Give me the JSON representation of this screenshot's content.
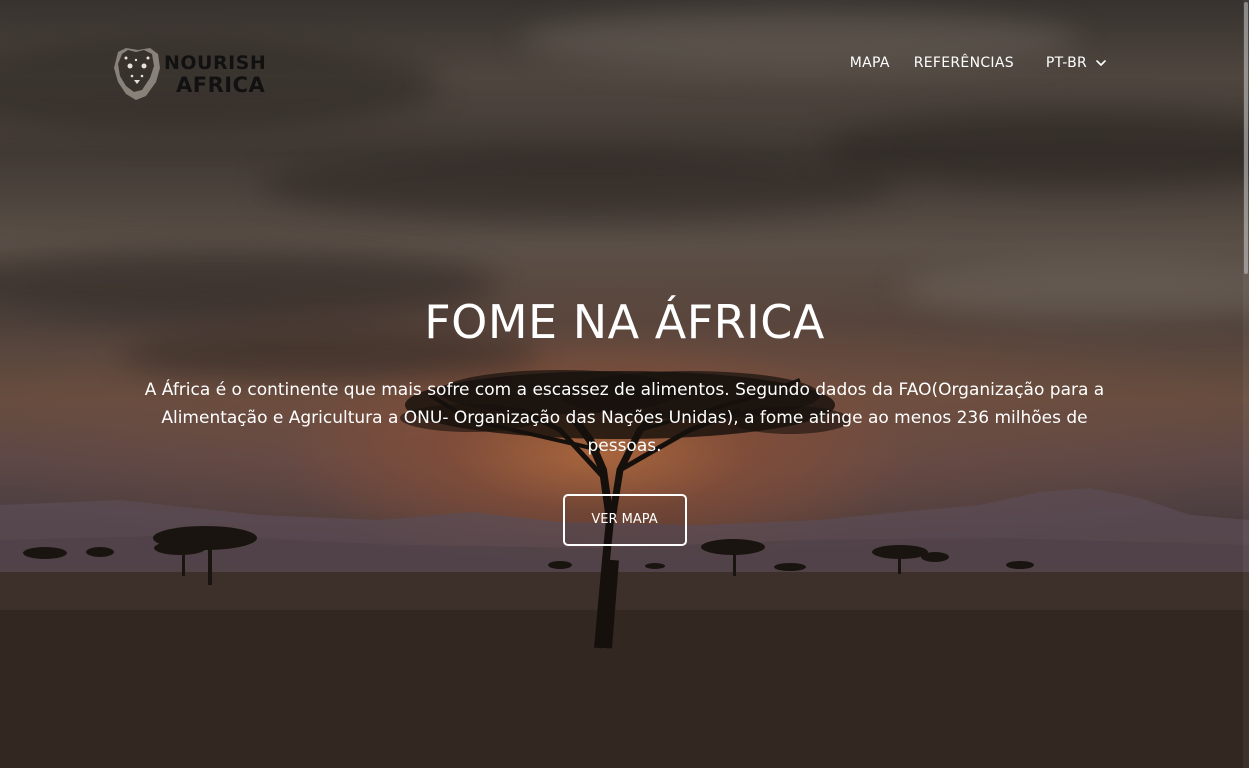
{
  "brand": {
    "line1": "NOURISH",
    "line2": "AFRICA",
    "logo_icon": "leopard-head-icon"
  },
  "nav": {
    "map": "MAPA",
    "references": "REFERÊNCIAS",
    "language": "PT-BR",
    "language_icon": "chevron-down-icon"
  },
  "hero": {
    "title": "FOME NA ÁFRICA",
    "text": "A África é o continente que mais sofre com a escassez de alimentos. Segundo dados da FAO(Organização para a Alimentação e Agricultura a ONU- Organização das Nações Unidas), a fome atinge ao menos 236 milhões de pessoas.",
    "button": "VER MAPA"
  },
  "colors": {
    "text": "#ffffff",
    "logo_text": "#111111",
    "sunset_glow": "#d67e46",
    "ground": "#2f2420"
  }
}
